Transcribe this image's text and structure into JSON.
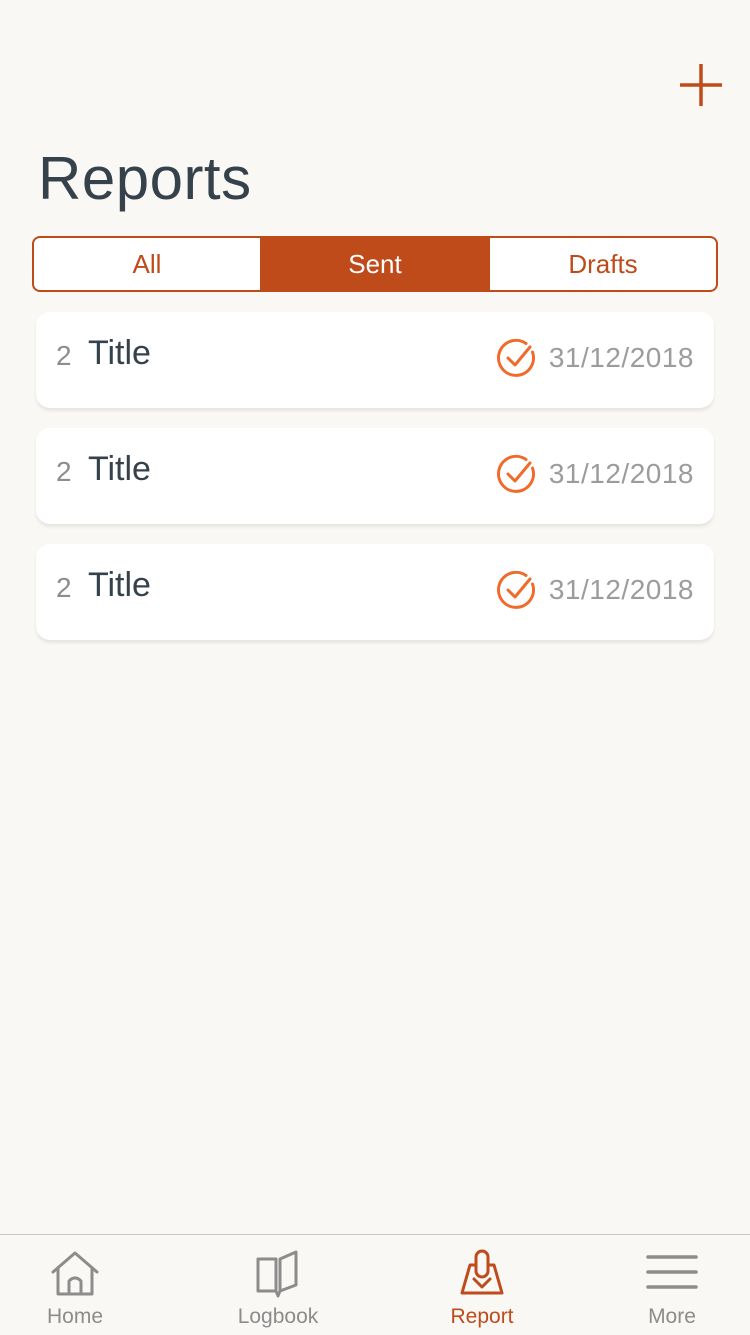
{
  "header": {
    "title": "Reports",
    "add_icon": "plus-icon"
  },
  "segments": [
    {
      "label": "All",
      "active": false
    },
    {
      "label": "Sent",
      "active": true
    },
    {
      "label": "Drafts",
      "active": false
    }
  ],
  "reports": [
    {
      "count": "2",
      "title": "Title",
      "status_icon": "check-circle-icon",
      "date": "31/12/2018"
    },
    {
      "count": "2",
      "title": "Title",
      "status_icon": "check-circle-icon",
      "date": "31/12/2018"
    },
    {
      "count": "2",
      "title": "Title",
      "status_icon": "check-circle-icon",
      "date": "31/12/2018"
    }
  ],
  "tabbar": {
    "items": [
      {
        "label": "Home",
        "icon": "home-icon",
        "active": false
      },
      {
        "label": "Logbook",
        "icon": "book-icon",
        "active": false
      },
      {
        "label": "Report",
        "icon": "report-icon",
        "active": true
      },
      {
        "label": "More",
        "icon": "menu-icon",
        "active": false
      }
    ]
  },
  "colors": {
    "accent": "#bf4a1a",
    "status": "#f06a2a",
    "title_text": "#36424b",
    "muted_text": "#9c9c9c",
    "background": "#faf8f5"
  }
}
